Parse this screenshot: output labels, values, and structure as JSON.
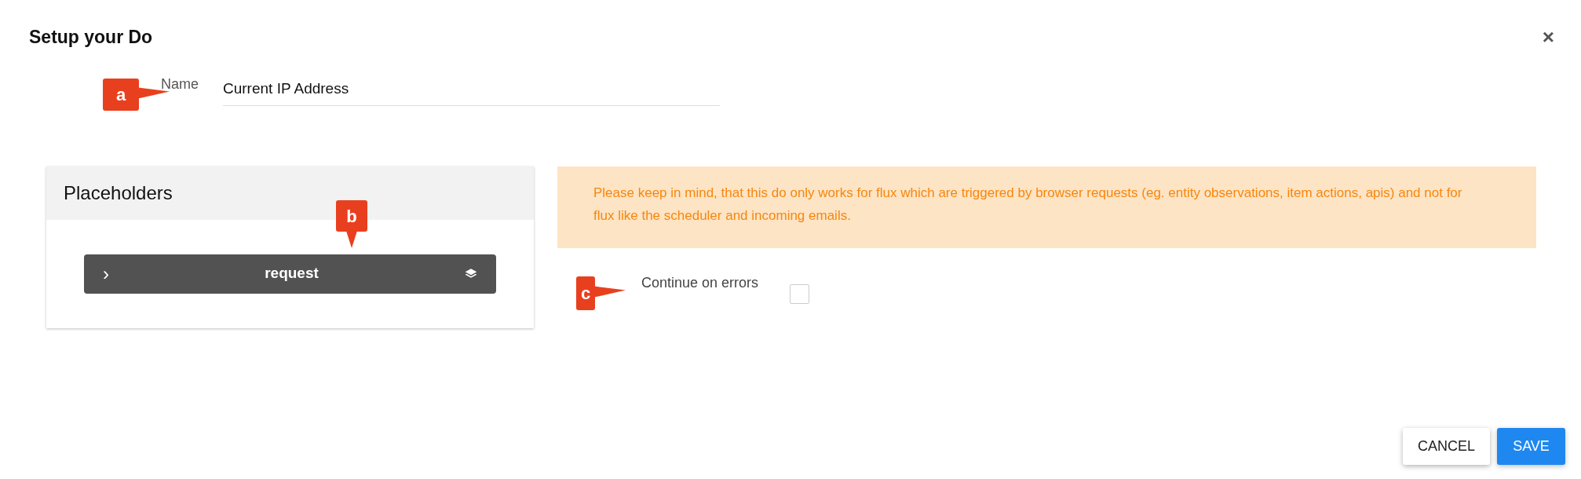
{
  "dialog": {
    "title": "Setup your Do",
    "close": "×"
  },
  "name_field": {
    "label": "Name",
    "value": "Current IP Address"
  },
  "placeholders": {
    "title": "Placeholders",
    "items": [
      {
        "expander": "›",
        "label": "request"
      }
    ]
  },
  "notice": "Please keep in mind, that this do only works for flux which are triggered by browser requests (eg. entity observations, item actions, apis) and not for flux like the scheduler and incoming emails.",
  "continue_on_errors": {
    "label": "Continue on errors",
    "checked": false
  },
  "annotations": [
    {
      "label": "a"
    },
    {
      "label": "b"
    },
    {
      "label": "c"
    }
  ],
  "buttons": [
    {
      "label": "CANCEL",
      "kind": "secondary"
    },
    {
      "label": "SAVE",
      "kind": "primary"
    }
  ]
}
